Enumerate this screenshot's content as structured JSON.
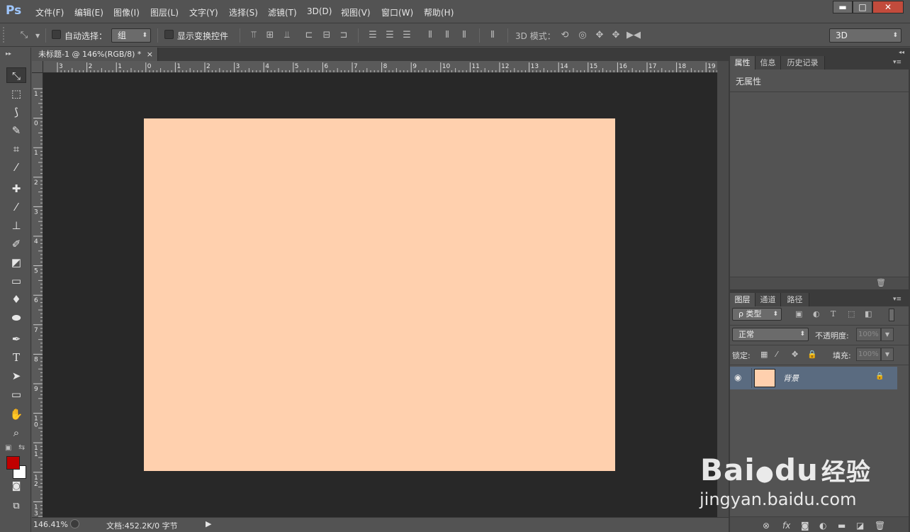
{
  "app": {
    "logo": "Ps"
  },
  "menu": {
    "items": [
      "文件(F)",
      "编辑(E)",
      "图像(I)",
      "图层(L)",
      "文字(Y)",
      "选择(S)",
      "滤镜(T)",
      "3D(D)",
      "视图(V)",
      "窗口(W)",
      "帮助(H)"
    ]
  },
  "window_controls": {
    "minimize": "▬",
    "maximize": "□",
    "close": "✕"
  },
  "options": {
    "auto_select_label": "自动选择：",
    "auto_select_value": "组",
    "show_transform_label": "显示变换控件",
    "mode_3d_label": "3D 模式：",
    "workspace_value": "3D"
  },
  "document": {
    "tab_title": "未标题-1 @ 146%(RGB/8) *",
    "tab_close": "×",
    "canvas_color": "#FFD0AE",
    "ruler_top_labels": [
      "3",
      "2",
      "1",
      "0",
      "1",
      "2",
      "3",
      "4",
      "5",
      "6",
      "7",
      "8",
      "9",
      "10",
      "11",
      "12",
      "13",
      "14",
      "15",
      "16",
      "17",
      "18",
      "19"
    ],
    "ruler_left_labels": [
      "1",
      "0",
      "1",
      "2",
      "3",
      "4",
      "5",
      "6",
      "7",
      "8",
      "9",
      "1 0",
      "1 1",
      "1 2",
      "1 3"
    ]
  },
  "status": {
    "zoom": "146.41%",
    "doc_info": "文档:452.2K/0 字节",
    "play": "▶"
  },
  "properties_panel": {
    "tabs": [
      "属性",
      "信息",
      "历史记录"
    ],
    "content": "无属性"
  },
  "layers_panel": {
    "tabs": [
      "图层",
      "通道",
      "路径"
    ],
    "filter_label": "ρ 类型",
    "blend_mode": "正常",
    "opacity_label": "不透明度:",
    "opacity_value": "100%",
    "lock_label": "锁定:",
    "fill_label": "填充:",
    "fill_value": "100%",
    "layers": [
      {
        "name": "背景",
        "color": "#FFD0AE",
        "locked": true
      }
    ]
  },
  "colors": {
    "foreground": "#C00000",
    "background": "#FFFFFF",
    "accent_selection": "#5A6B80"
  },
  "watermark": {
    "brand": "Bai",
    "brand2": "du",
    "product": "经验",
    "url": "jingyan.baidu.com"
  }
}
